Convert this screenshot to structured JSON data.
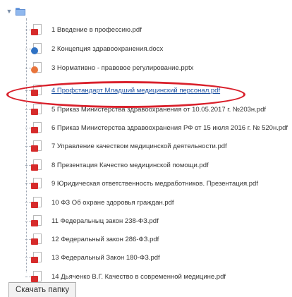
{
  "tree": {
    "toggle_glyph": "▼",
    "files": [
      {
        "label": "1 Введение в профессию.pdf",
        "type": "pdf"
      },
      {
        "label": "2 Концепция здравоохранения.docx",
        "type": "docx"
      },
      {
        "label": "3 Нормативно - правовое регулирование.pptx",
        "type": "pptx"
      },
      {
        "label": "4 Профстандарт Младший медицинский персонал.pdf",
        "type": "pdf"
      },
      {
        "label": "5 Приказ Министерства здравоохранения от 10.05.2017 г. №203н.pdf",
        "type": "pdf"
      },
      {
        "label": "6 Приказ Министерства здравоохранения РФ от 15 июля 2016 г. № 520н.pdf",
        "type": "pdf"
      },
      {
        "label": "7 Управление качеством медицинской деятельности.pdf",
        "type": "pdf"
      },
      {
        "label": "8 Презентация Качество медицинской помощи.pdf",
        "type": "pdf"
      },
      {
        "label": "9 Юридическая ответственность медработников. Презентация.pdf",
        "type": "pdf"
      },
      {
        "label": "10 ФЗ Об охране здоровья граждан.pdf",
        "type": "pdf"
      },
      {
        "label": "11 Федеральныц закон 238-ФЗ.pdf",
        "type": "pdf"
      },
      {
        "label": "12 Федеральный закон 286-ФЗ.pdf",
        "type": "pdf"
      },
      {
        "label": "13 Федеральный Закон 180-ФЗ.pdf",
        "type": "pdf"
      },
      {
        "label": "14 Дьяченко В.Г. Качество в современной медицине.pdf",
        "type": "pdf"
      }
    ]
  },
  "download_button": {
    "label": "Скачать папку"
  },
  "colors": {
    "highlight": "#d9202b",
    "link_active": "#1a4fa0"
  }
}
